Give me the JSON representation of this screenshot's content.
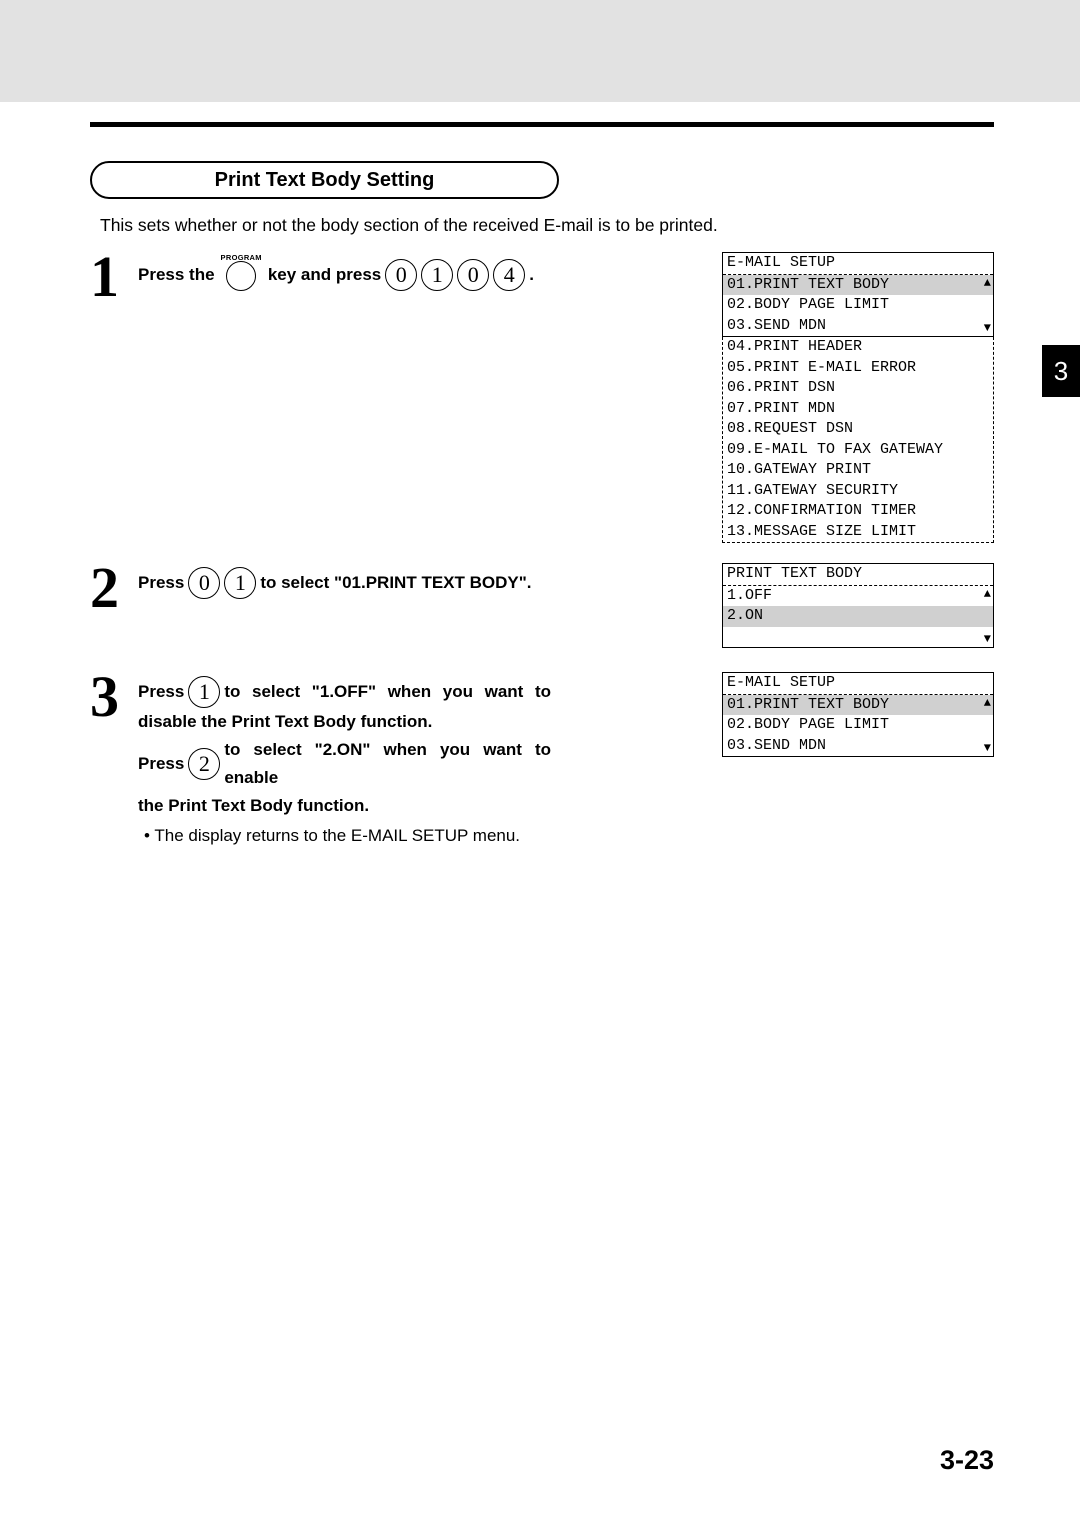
{
  "section_title": "Print Text Body Setting",
  "intro": "This sets whether or not the body section of the received E-mail is to be printed.",
  "chapter_tab": "3",
  "page_number": "3-23",
  "step1": {
    "num": "1",
    "pre": "Press the",
    "program_label": "PROGRAM",
    "mid": "key and press",
    "k1": "0",
    "k2": "1",
    "k3": "0",
    "k4": "4",
    "end": "."
  },
  "lcd1": {
    "title": "E-MAIL SETUP",
    "rows": [
      "01.PRINT TEXT BODY",
      "02.BODY PAGE LIMIT",
      "03.SEND MDN"
    ],
    "ext": [
      "04.PRINT HEADER",
      "05.PRINT E-MAIL ERROR",
      "06.PRINT DSN",
      "07.PRINT MDN",
      "08.REQUEST DSN",
      "09.E-MAIL TO FAX GATEWAY",
      "10.GATEWAY PRINT",
      "11.GATEWAY SECURITY",
      "12.CONFIRMATION TIMER",
      "13.MESSAGE SIZE LIMIT"
    ]
  },
  "step2": {
    "num": "2",
    "pre": "Press",
    "k1": "0",
    "k2": "1",
    "post": "to select \"01.PRINT TEXT BODY\"."
  },
  "lcd2": {
    "title": "PRINT TEXT BODY",
    "rows": [
      "1.OFF",
      "2.ON",
      " "
    ]
  },
  "step3": {
    "num": "3",
    "line1a": "Press",
    "k1": "1",
    "line1b": "to select \"1.OFF\" when you want to",
    "line2": "disable the Print Text Body function.",
    "line3a": "Press",
    "k2": "2",
    "line3b": "to select \"2.ON\" when you want to enable",
    "line4": "the Print Text Body function."
  },
  "lcd3": {
    "title": "E-MAIL SETUP",
    "rows": [
      "01.PRINT TEXT BODY",
      "02.BODY PAGE LIMIT",
      "03.SEND MDN"
    ]
  },
  "note": "The display returns to the E-MAIL SETUP menu."
}
